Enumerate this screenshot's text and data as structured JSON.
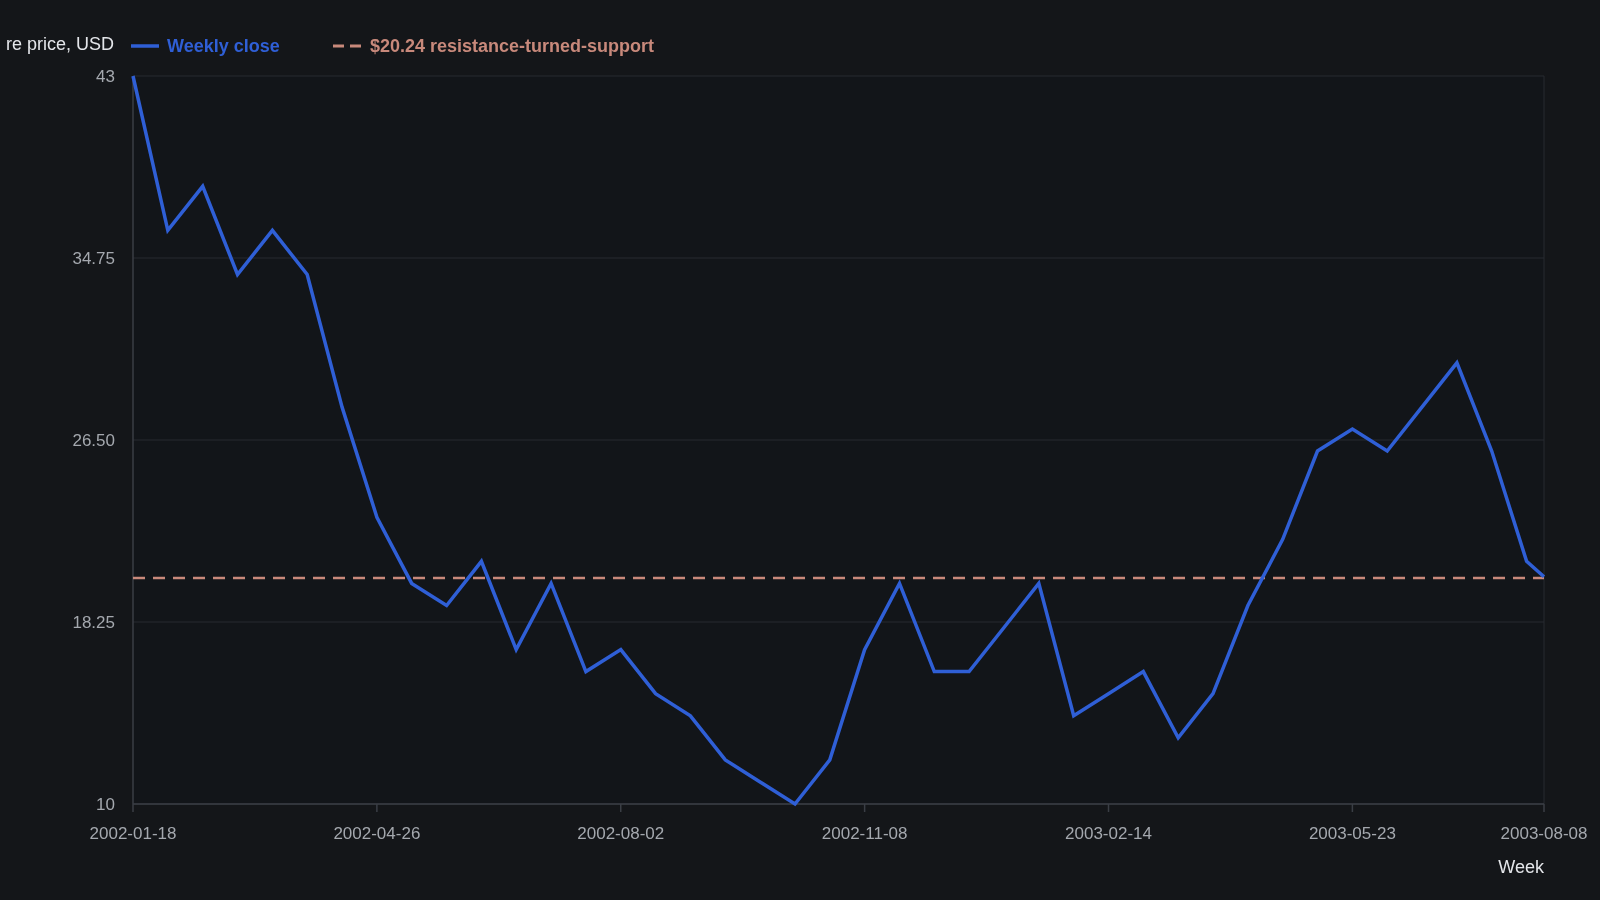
{
  "chart_data": {
    "type": "line",
    "ylabel": "re price, USD",
    "xlabel": "Week",
    "x": [
      "2002-01-18",
      "2002-02-01",
      "2002-02-15",
      "2002-03-01",
      "2002-03-15",
      "2002-03-29",
      "2002-04-12",
      "2002-04-26",
      "2002-05-10",
      "2002-05-24",
      "2002-06-07",
      "2002-06-21",
      "2002-07-05",
      "2002-07-19",
      "2002-08-02",
      "2002-08-16",
      "2002-08-30",
      "2002-09-13",
      "2002-09-27",
      "2002-10-11",
      "2002-10-25",
      "2002-11-08",
      "2002-11-22",
      "2002-12-06",
      "2002-12-20",
      "2003-01-03",
      "2003-01-17",
      "2003-01-31",
      "2003-02-14",
      "2003-02-28",
      "2003-03-14",
      "2003-03-28",
      "2003-04-11",
      "2003-04-25",
      "2003-05-09",
      "2003-05-23",
      "2003-06-06",
      "2003-06-20",
      "2003-07-04",
      "2003-07-18",
      "2003-08-01",
      "2003-08-08"
    ],
    "series": [
      {
        "name": "Weekly close",
        "color": "#2f5fd6",
        "values": [
          43,
          36,
          38,
          34,
          36,
          34,
          28,
          23,
          20,
          19,
          21,
          17,
          20,
          16,
          17,
          15,
          14,
          12,
          11,
          10,
          12,
          17,
          20,
          16,
          16,
          18,
          20,
          14,
          15,
          16,
          13,
          15,
          19,
          22,
          26,
          27,
          26,
          28,
          30,
          26,
          21,
          20.3
        ]
      }
    ],
    "ylim": [
      10,
      43
    ],
    "yticks": [
      {
        "value": 10,
        "label": "10"
      },
      {
        "value": 18.25,
        "label": "18.25"
      },
      {
        "value": 26.5,
        "label": "26.50"
      },
      {
        "value": 34.75,
        "label": "34.75"
      },
      {
        "value": 43,
        "label": "43"
      }
    ],
    "xticks": [
      {
        "value": "2002-01-18",
        "label": "2002-01-18"
      },
      {
        "value": "2002-04-26",
        "label": "2002-04-26"
      },
      {
        "value": "2002-08-02",
        "label": "2002-08-02"
      },
      {
        "value": "2002-11-08",
        "label": "2002-11-08"
      },
      {
        "value": "2003-02-14",
        "label": "2003-02-14"
      },
      {
        "value": "2003-05-23",
        "label": "2003-05-23"
      },
      {
        "value": "2003-08-08",
        "label": "2003-08-08"
      }
    ],
    "xlim": [
      "2002-01-18",
      "2003-08-08"
    ],
    "grid": true,
    "legend": true,
    "ref_lines": [
      {
        "axis": "y",
        "value": 20.24,
        "label": "$20.24 resistance-turned-support",
        "color": "#c8897b"
      }
    ]
  }
}
